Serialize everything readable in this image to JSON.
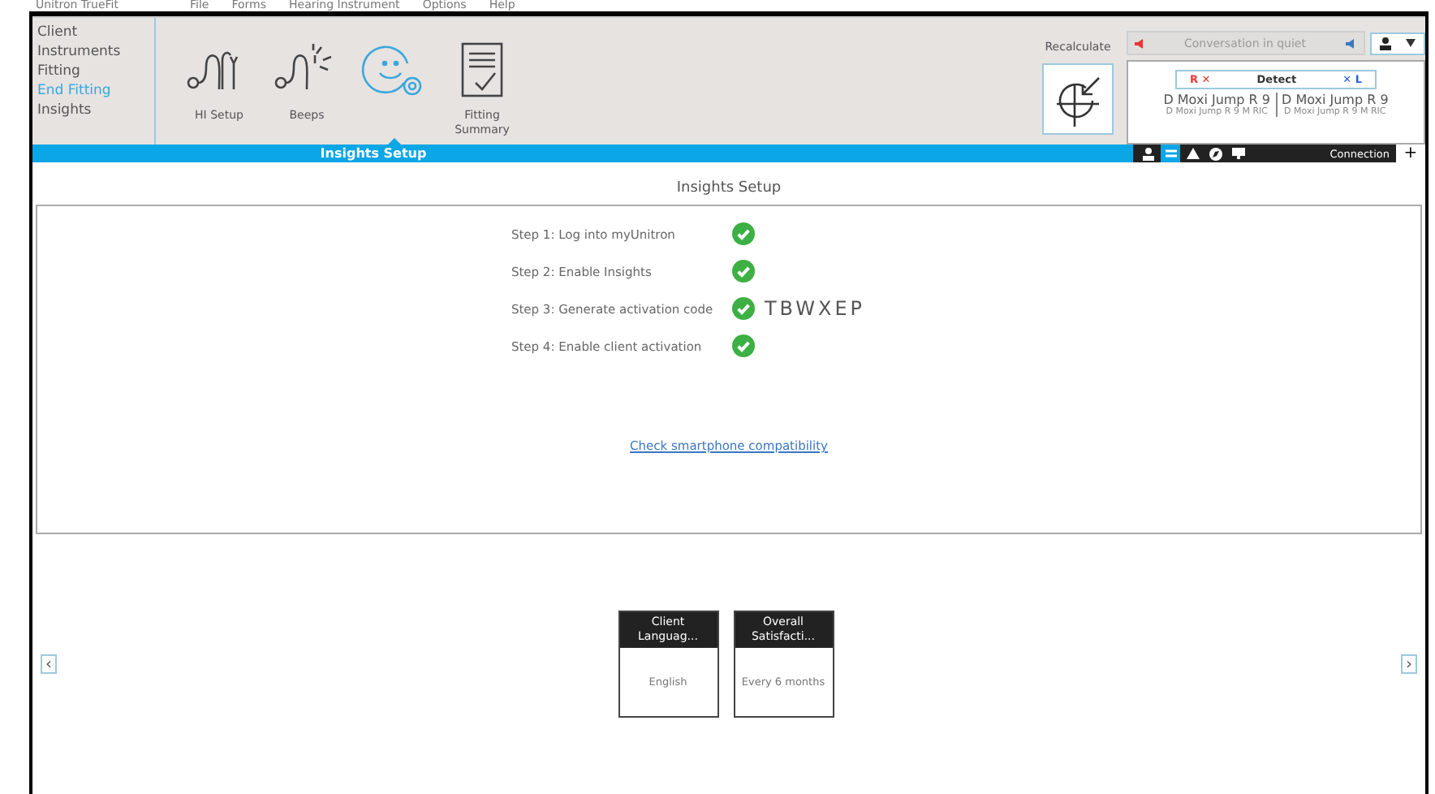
{
  "app_title": "Unitron TrueFit",
  "menu": [
    "File",
    "Forms",
    "Hearing Instrument",
    "Options",
    "Help"
  ],
  "nav": [
    {
      "label": "Client",
      "selected": false
    },
    {
      "label": "Instruments",
      "selected": false
    },
    {
      "label": "Fitting",
      "selected": false
    },
    {
      "label": "End Fitting",
      "selected": true
    },
    {
      "label": "Insights",
      "selected": false
    }
  ],
  "tiles": [
    {
      "label": "HI Setup",
      "kind": "setup",
      "selected": false
    },
    {
      "label": "Beeps",
      "kind": "beeps",
      "selected": false
    },
    {
      "kind": "insights",
      "selected": true
    },
    {
      "label": "Fitting Summary",
      "kind": "summary",
      "selected": false
    }
  ],
  "recalculate": {
    "label": "Recalculate"
  },
  "program": {
    "label": "Conversation in quiet"
  },
  "detect": {
    "right": "R ✕",
    "label": "Detect",
    "left": "✕ L"
  },
  "devices": [
    {
      "name": "D Moxi Jump R 9",
      "model": "D Moxi Jump R 9 M RIC"
    },
    {
      "name": "D Moxi Jump R 9",
      "model": "D Moxi Jump R 9 M RIC"
    }
  ],
  "section_bar": {
    "title": "Insights Setup"
  },
  "toolbar": [
    {
      "kind": "person",
      "selected": false
    },
    {
      "kind": "transfer",
      "selected": true
    },
    {
      "kind": "warning",
      "selected": false
    },
    {
      "kind": "compass",
      "selected": false
    },
    {
      "kind": "monitor",
      "selected": false
    }
  ],
  "connection": {
    "label": "Connection",
    "add": "+"
  },
  "page_title": "Insights Setup",
  "steps": [
    {
      "label": "Step 1: Log into myUnitron",
      "checked": true
    },
    {
      "label": "Step 2: Enable Insights",
      "checked": true
    },
    {
      "label": "Step 3: Generate activation code",
      "checked": true,
      "code": "TBWXEP"
    },
    {
      "label": "Step 4: Enable client activation",
      "checked": true
    }
  ],
  "link": "Check smartphone compatibility",
  "cards": [
    {
      "title": "Client Languag...",
      "value": "English"
    },
    {
      "title": "Overall Satisfacti...",
      "value": "Every 6 months"
    }
  ],
  "nav_arrows": {
    "prev": "‹",
    "next": "›"
  }
}
